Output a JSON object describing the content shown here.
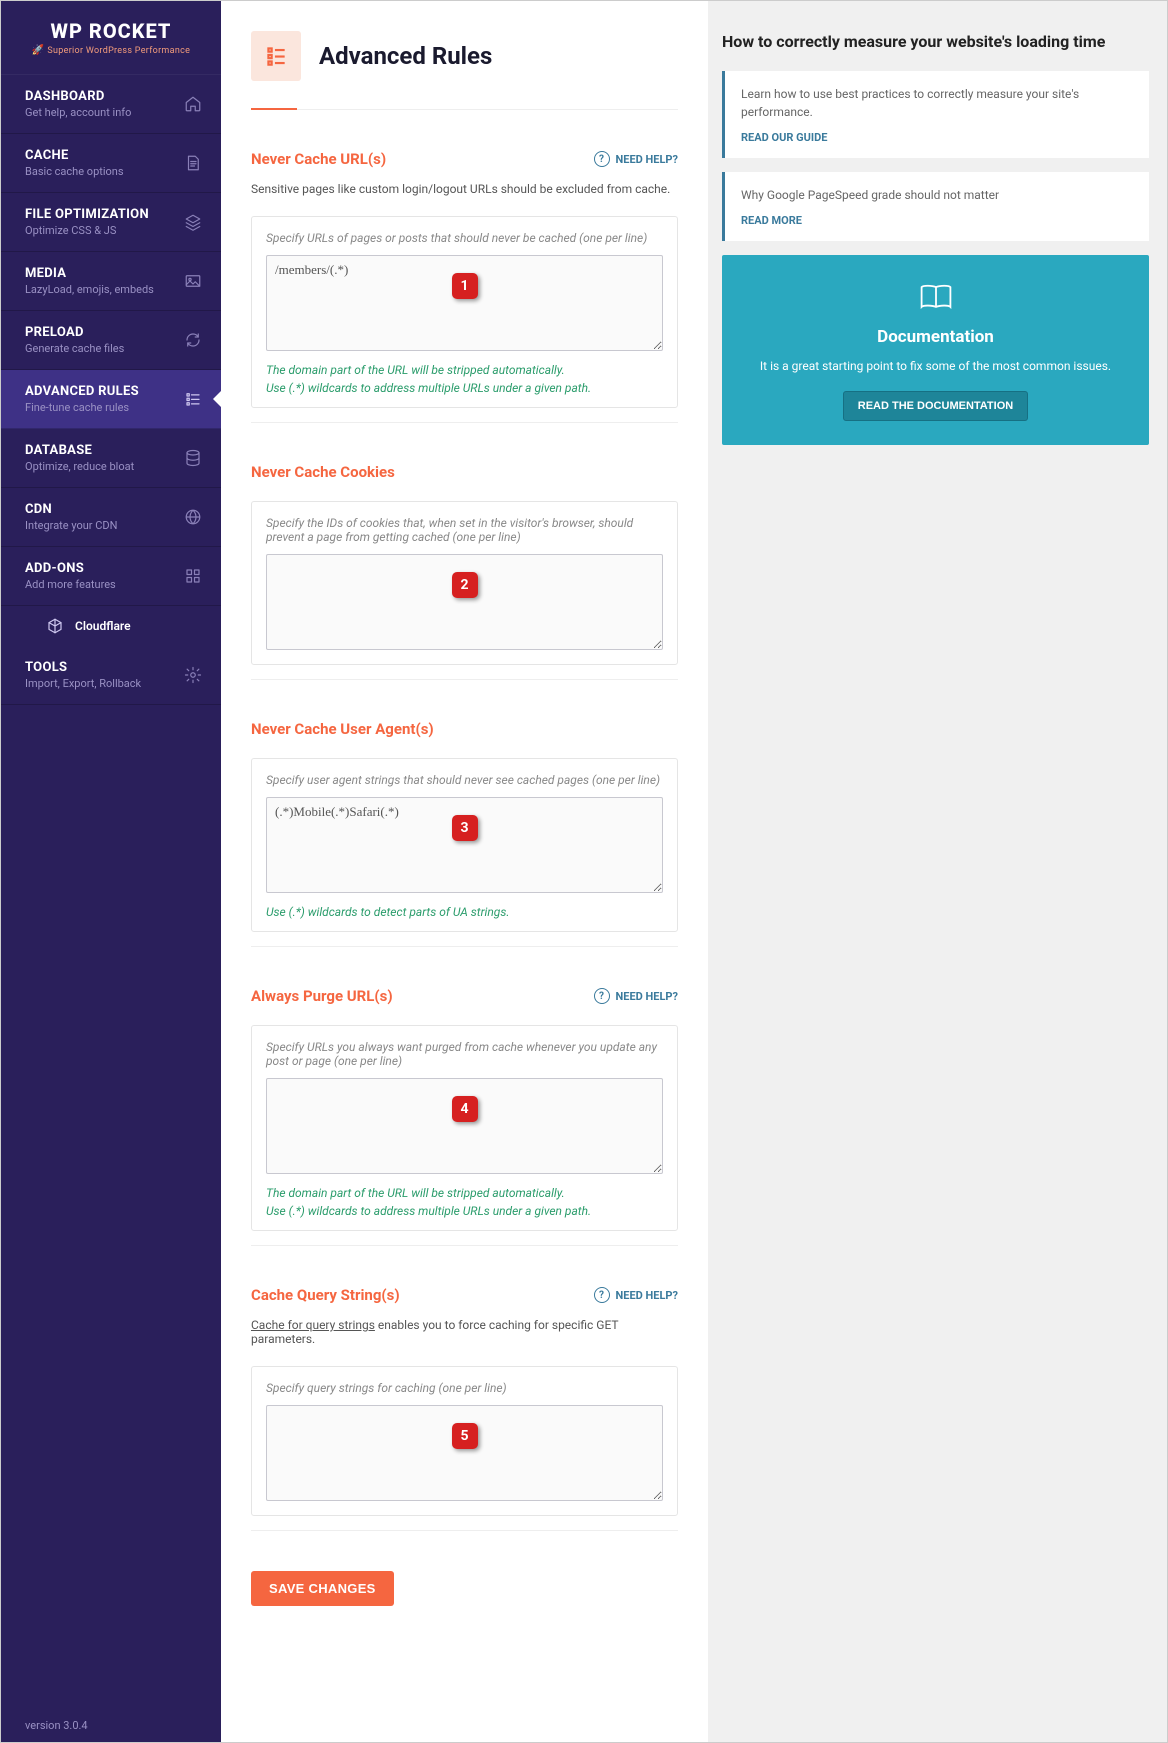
{
  "brand": {
    "name": "WP ROCKET",
    "tagline": "Superior WordPress Performance"
  },
  "nav": [
    {
      "title": "DASHBOARD",
      "desc": "Get help, account info",
      "icon": "home"
    },
    {
      "title": "CACHE",
      "desc": "Basic cache options",
      "icon": "file"
    },
    {
      "title": "FILE OPTIMIZATION",
      "desc": "Optimize CSS & JS",
      "icon": "layers"
    },
    {
      "title": "MEDIA",
      "desc": "LazyLoad, emojis, embeds",
      "icon": "image"
    },
    {
      "title": "PRELOAD",
      "desc": "Generate cache files",
      "icon": "refresh"
    },
    {
      "title": "ADVANCED RULES",
      "desc": "Fine-tune cache rules",
      "icon": "sliders"
    },
    {
      "title": "DATABASE",
      "desc": "Optimize, reduce bloat",
      "icon": "db"
    },
    {
      "title": "CDN",
      "desc": "Integrate your CDN",
      "icon": "globe"
    },
    {
      "title": "ADD-ONS",
      "desc": "Add more features",
      "icon": "grid"
    }
  ],
  "nav_cloudflare": "Cloudflare",
  "nav_tools": {
    "title": "TOOLS",
    "desc": "Import, Export, Rollback",
    "icon": "gear"
  },
  "version": "version 3.0.4",
  "page_title": "Advanced Rules",
  "help_label": "NEED HELP?",
  "sections": [
    {
      "title": "Never Cache URL(s)",
      "help": true,
      "desc": "Sensitive pages like custom login/logout URLs should be excluded from cache.",
      "hint": "Specify URLs of pages or posts that should never be cached (one per line)",
      "value": "/members/(.*)",
      "note": "The domain part of the URL will be stripped automatically.\nUse (.*) wildcards to address multiple URLs under a given path.",
      "marker": "1"
    },
    {
      "title": "Never Cache Cookies",
      "help": false,
      "desc": "",
      "hint": "Specify the IDs of cookies that, when set in the visitor's browser, should prevent a page from getting cached (one per line)",
      "value": "",
      "note": "",
      "marker": "2"
    },
    {
      "title": "Never Cache User Agent(s)",
      "help": false,
      "desc": "",
      "hint": "Specify user agent strings that should never see cached pages (one per line)",
      "value": "(.*)Mobile(.*)Safari(.*)",
      "note": "Use (.*) wildcards to detect parts of UA strings.",
      "marker": "3"
    },
    {
      "title": "Always Purge URL(s)",
      "help": true,
      "desc": "",
      "hint": "Specify URLs you always want purged from cache whenever you update any post or page (one per line)",
      "value": "",
      "note": "The domain part of the URL will be stripped automatically.\nUse (.*) wildcards to address multiple URLs under a given path.",
      "marker": "4"
    },
    {
      "title": "Cache Query String(s)",
      "help": true,
      "desc_html": true,
      "desc_link": "Cache for query strings",
      "desc_rest": " enables you to force caching for specific GET parameters.",
      "hint": "Specify query strings for caching (one per line)",
      "value": "",
      "note": "",
      "marker": "5"
    }
  ],
  "save": "SAVE CHANGES",
  "right": {
    "title": "How to correctly measure your website's loading time",
    "card1": {
      "text": "Learn how to use best practices to correctly measure your site's performance.",
      "link": "READ OUR GUIDE"
    },
    "card2": {
      "text": "Why Google PageSpeed grade should not matter",
      "link": "READ MORE"
    },
    "doc": {
      "title": "Documentation",
      "desc": "It is a great starting point to fix some of the most common issues.",
      "btn": "READ THE DOCUMENTATION"
    }
  }
}
